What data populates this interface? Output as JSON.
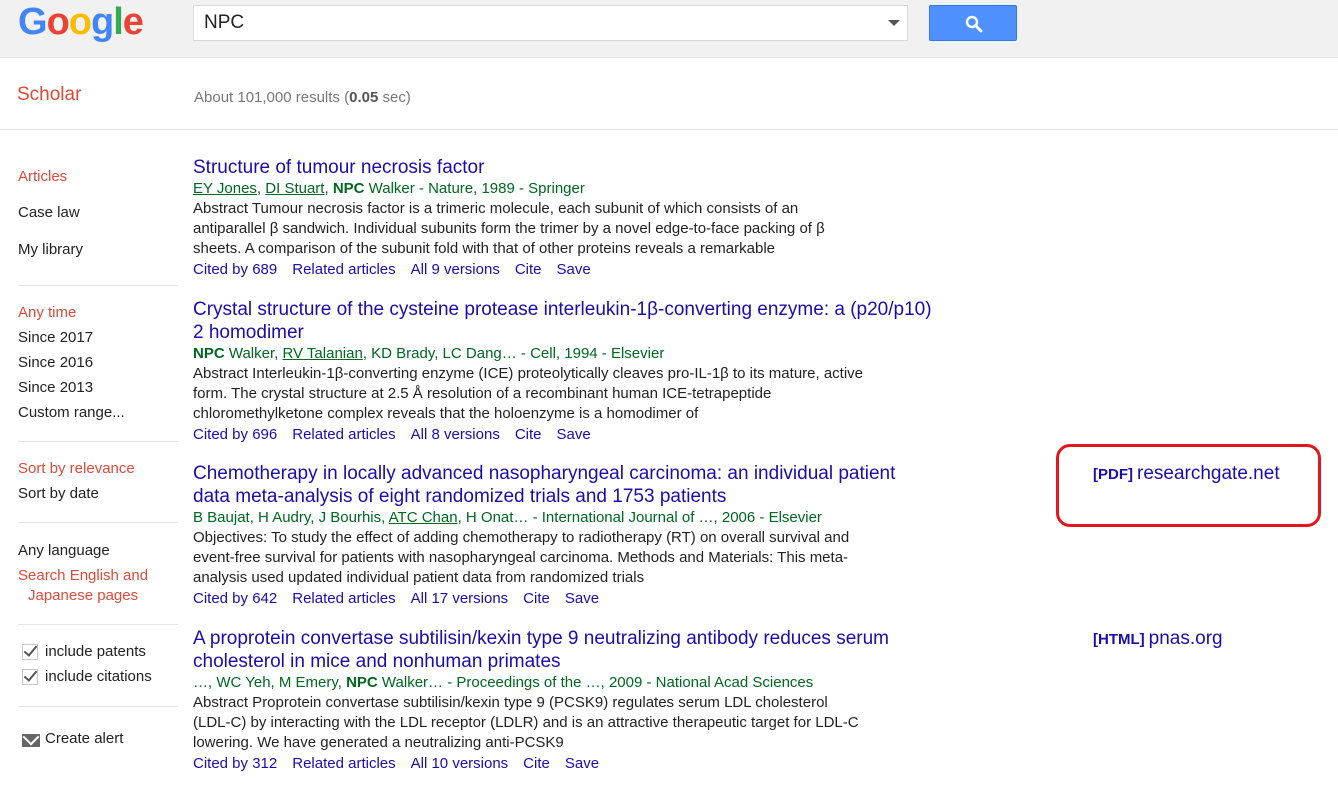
{
  "header": {
    "logo": [
      "G",
      "o",
      "o",
      "g",
      "l",
      "e"
    ],
    "logo_colors": [
      "#4285f4",
      "#ea4335",
      "#fbbc05",
      "#4285f4",
      "#34a853",
      "#ea4335"
    ],
    "search_value": "NPC",
    "search_icon": "search-icon"
  },
  "subheader": {
    "brand": "Scholar",
    "results_prefix": "About 101,000 results (",
    "results_time": "0.05",
    "results_suffix": " sec)"
  },
  "sidebar": {
    "types": [
      {
        "label": "Articles",
        "active": true
      },
      {
        "label": "Case law",
        "active": false
      },
      {
        "label": "My library",
        "active": false
      }
    ],
    "time": [
      {
        "label": "Any time",
        "active": true
      },
      {
        "label": "Since 2017",
        "active": false
      },
      {
        "label": "Since 2016",
        "active": false
      },
      {
        "label": "Since 2013",
        "active": false
      },
      {
        "label": "Custom range...",
        "active": false
      }
    ],
    "sort": [
      {
        "label": "Sort by relevance",
        "active": true
      },
      {
        "label": "Sort by date",
        "active": false
      }
    ],
    "language": [
      {
        "label": "Any language",
        "active": false
      },
      {
        "label": "Search English and",
        "active": true
      },
      {
        "label": "Japanese pages",
        "active": true
      }
    ],
    "checks": [
      {
        "label": "include patents",
        "checked": true
      },
      {
        "label": "include citations",
        "checked": true
      }
    ],
    "alert": "Create alert"
  },
  "results": [
    {
      "title": "Structure of tumour necrosis factor",
      "authors_html": [
        {
          "t": "EY Jones",
          "u": true
        },
        {
          "t": ", "
        },
        {
          "t": "DI Stuart",
          "u": true
        },
        {
          "t": ", "
        },
        {
          "t": "NPC",
          "b": true
        },
        {
          "t": " Walker - Nature, 1989 - Springer"
        }
      ],
      "snippet": "Abstract Tumour necrosis factor is a trimeric molecule, each subunit of which consists of an antiparallel β sandwich. Individual subunits form the trimer by a novel edge-to-face packing of β sheets. A comparison of the subunit fold with that of other proteins reveals a remarkable",
      "links": [
        "Cited by 689",
        "Related articles",
        "All 9 versions",
        "Cite",
        "Save"
      ]
    },
    {
      "title": "Crystal structure of the cysteine protease interleukin-1β-converting enzyme: a (p20/p10) 2 homodimer",
      "authors_html": [
        {
          "t": "NPC",
          "b": true
        },
        {
          "t": " Walker, "
        },
        {
          "t": "RV Talanian",
          "u": true
        },
        {
          "t": ", KD Brady, LC Dang… - Cell, 1994 - Elsevier"
        }
      ],
      "snippet": "Abstract Interleukin-1β-converting enzyme (ICE) proteolytically cleaves pro-IL-1β to its mature, active form. The crystal structure at 2.5 Å resolution of a recombinant human ICE-tetrapeptide chloromethylketone complex reveals that the holoenzyme is a homodimer of",
      "links": [
        "Cited by 696",
        "Related articles",
        "All 8 versions",
        "Cite",
        "Save"
      ]
    },
    {
      "title": "Chemotherapy in locally advanced nasopharyngeal carcinoma: an individual patient data meta-analysis of eight randomized trials and 1753 patients",
      "authors_html": [
        {
          "t": "B Baujat, H Audry, J Bourhis, "
        },
        {
          "t": "ATC Chan",
          "u": true
        },
        {
          "t": ", H Onat… - International Journal of …, 2006 - Elsevier"
        }
      ],
      "snippet": "Objectives: To study the effect of adding chemotherapy to radiotherapy (RT) on overall survival and event-free survival for patients with nasopharyngeal carcinoma. Methods and Materials: This meta-analysis used updated individual patient data from randomized trials",
      "links": [
        "Cited by 642",
        "Related articles",
        "All 17 versions",
        "Cite",
        "Save"
      ],
      "side": {
        "tag": "[PDF]",
        "domain": "researchgate.net"
      }
    },
    {
      "title": "A proprotein convertase subtilisin/kexin type 9 neutralizing antibody reduces serum cholesterol in mice and nonhuman primates",
      "authors_html": [
        {
          "t": "…, WC Yeh, M Emery, "
        },
        {
          "t": "NPC",
          "b": true
        },
        {
          "t": " Walker… - Proceedings of the …, 2009 - National Acad Sciences"
        }
      ],
      "snippet": "Abstract Proprotein convertase subtilisin/kexin type 9 (PCSK9) regulates serum LDL cholesterol (LDL-C) by interacting with the LDL receptor (LDLR) and is an attractive therapeutic target for LDL-C lowering. We have generated a neutralizing anti-PCSK9",
      "links": [
        "Cited by 312",
        "Related articles",
        "All 10 versions",
        "Cite",
        "Save"
      ],
      "side": {
        "tag": "[HTML]",
        "domain": "pnas.org"
      }
    }
  ]
}
